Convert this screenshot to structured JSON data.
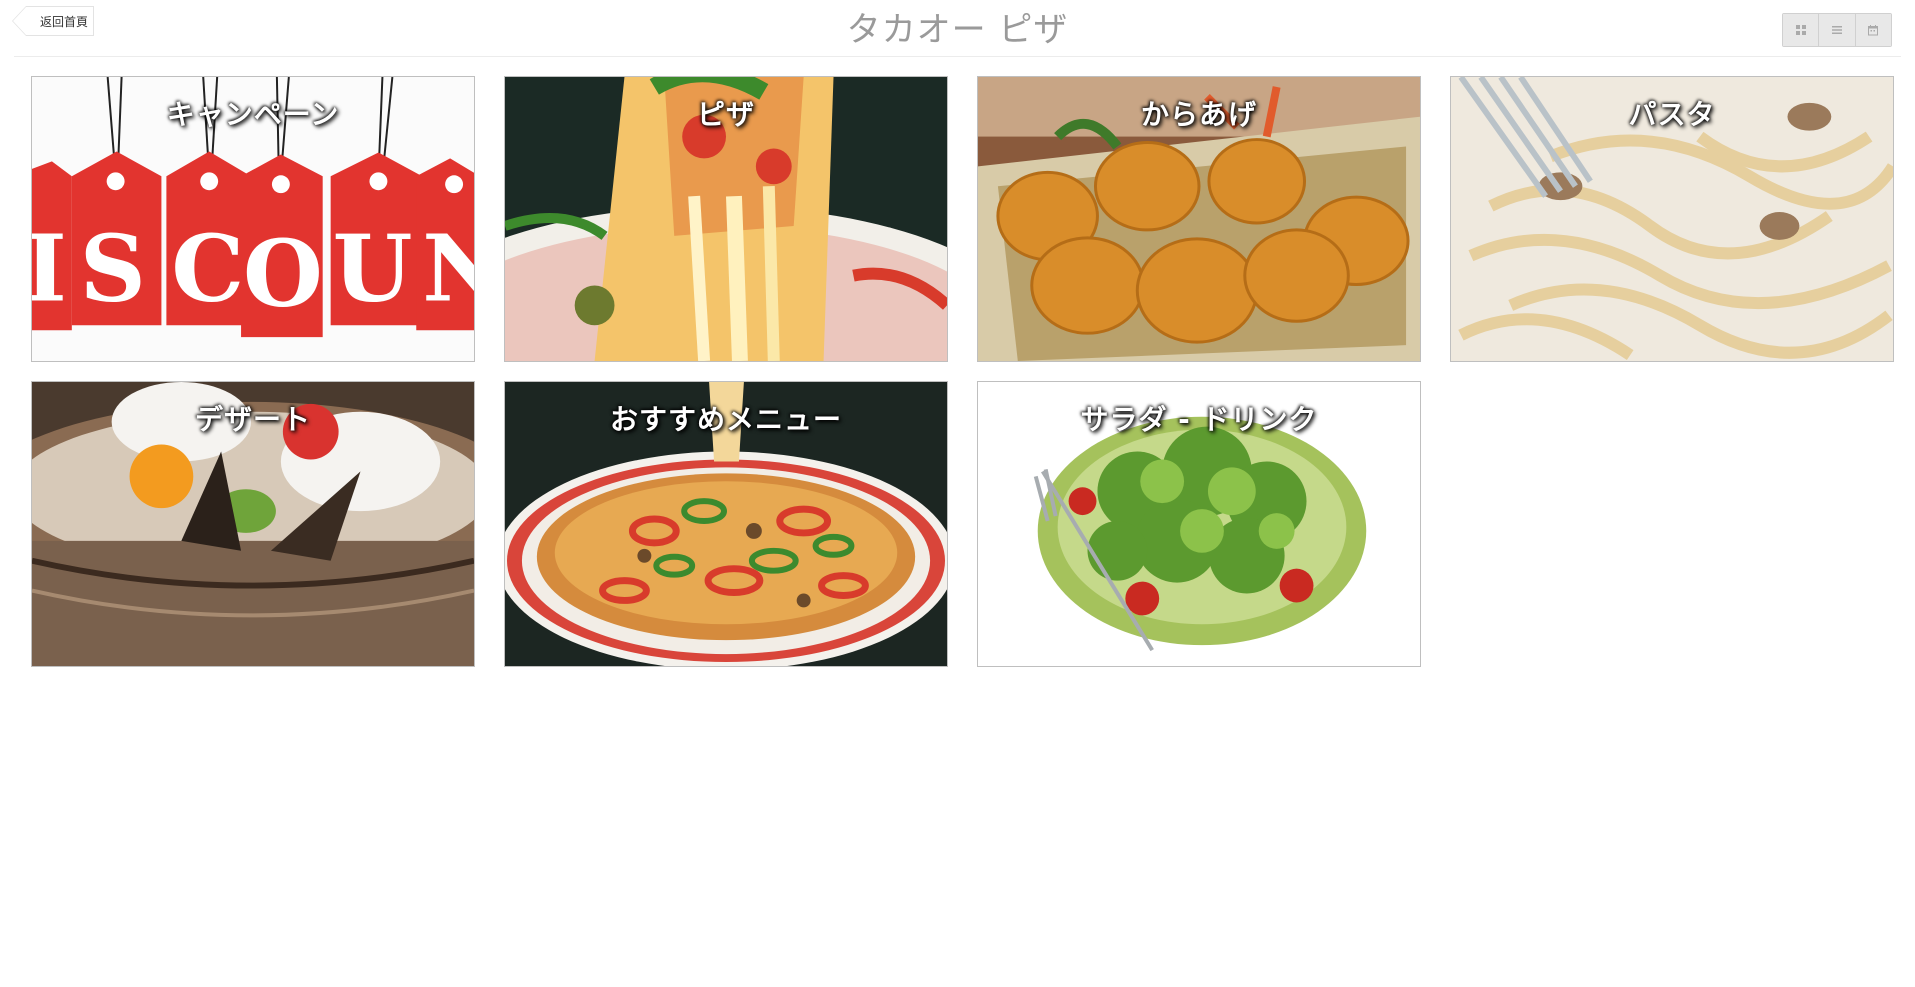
{
  "header": {
    "back_label": "返回首頁",
    "title": "タカオー ピザ"
  },
  "view_toggle": {
    "icons": [
      "grid-icon",
      "list-icon",
      "calendar-icon"
    ]
  },
  "categories": [
    {
      "label": "キャンペーン",
      "image": "discount-tags-image"
    },
    {
      "label": "ピザ",
      "image": "pizza-slice-image"
    },
    {
      "label": "からあげ",
      "image": "fried-chicken-image"
    },
    {
      "label": "パスタ",
      "image": "pasta-image"
    },
    {
      "label": "デザート",
      "image": "cake-image"
    },
    {
      "label": "おすすめメニュー",
      "image": "pizza-whole-image"
    },
    {
      "label": "サラダ - ドリンク",
      "image": "salad-image"
    }
  ],
  "discount_letters": "ISCOUN"
}
